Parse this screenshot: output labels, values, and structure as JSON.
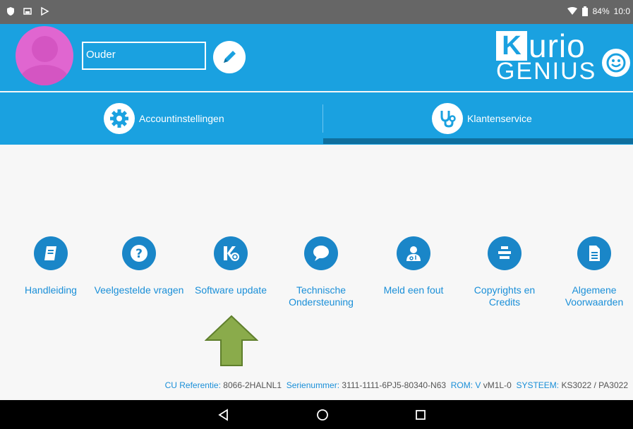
{
  "status": {
    "battery": "84%",
    "time": "10:0"
  },
  "profile": {
    "name_value": "Ouder"
  },
  "logo": {
    "k": "K",
    "urio": "urio",
    "genius": "GENIUS"
  },
  "tabs": [
    {
      "label": "Accountinstellingen",
      "icon": "gear-icon",
      "selected": false
    },
    {
      "label": "Klantenservice",
      "icon": "stethoscope-icon",
      "selected": true
    }
  ],
  "items": [
    {
      "label": "Handleiding",
      "icon": "book-icon"
    },
    {
      "label": "Veelgestelde vragen",
      "icon": "question-icon"
    },
    {
      "label": "Software update",
      "icon": "kurio-update-icon"
    },
    {
      "label": "Technische Ondersteuning",
      "icon": "speech-bubble-icon"
    },
    {
      "label": "Meld een fout",
      "icon": "doctor-icon"
    },
    {
      "label": "Copyrights en Credits",
      "icon": "stack-icon"
    },
    {
      "label": "Algemene Voorwaarden",
      "icon": "document-icon"
    }
  ],
  "footer": {
    "cu_label": "CU Referentie:",
    "cu_value": "8066-2HALNL1",
    "serial_label": "Serienummer:",
    "serial_value": "3111-1111-6PJ5-80340-N63",
    "rom_label": "ROM: V",
    "rom_value": "vM1L-0",
    "system_label": "SYSTEEM:",
    "system_value": "KS3022 / PA3022"
  },
  "colors": {
    "header": "#1aa1e0",
    "icon_blue": "#1a86c8",
    "avatar_pink": "#e066d0",
    "arrow_green": "#8aab4b"
  }
}
